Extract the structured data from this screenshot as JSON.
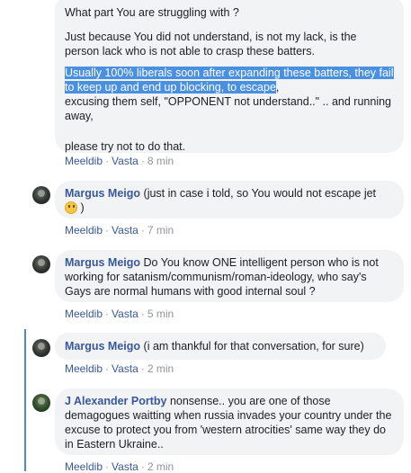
{
  "comments": [
    {
      "paragraphs": [
        "What part You are struggling with ?",
        "Just because You did not understand, is not my lack, is the person lack who is not able to crasp these batters."
      ],
      "selected_text": "Usually 100% liberals soon after expanding these batters, they fail to keep up and end up blocking, to escape",
      "after_selected": ",",
      "line_a": "excusing them self, \"OPPONENT not understand..\" .. and running away,",
      "line_b": "please try not to do that.",
      "actions": {
        "like": "Meeldib",
        "reply": "Vasta",
        "time": "8 min"
      }
    },
    {
      "author": "Margus Meigo",
      "text": "(just in case i told, so You would not escape jet",
      "text_after_emoji": ")",
      "emoji": "grinning-emoji",
      "actions": {
        "like": "Meeldib",
        "reply": "Vasta",
        "time": "7 min"
      }
    },
    {
      "author": "Margus Meigo",
      "text": "Do You know ONE intelligent person who is not working for satanism/communism/roman-ideology, who say's Gays are normal humans with good internal soul ?",
      "actions": {
        "like": "Meeldib",
        "reply": "Vasta",
        "time": "5 min"
      }
    },
    {
      "author": "Margus Meigo",
      "text": "(i am thankful for that conversation, for sure)",
      "actions": {
        "like": "Meeldib",
        "reply": "Vasta",
        "time": "2 min"
      }
    },
    {
      "author": "J Alexander Portby",
      "text": "nonsense.. you are one of those demagogues waitting when russia invades your country under the excuse to protect you from 'western atrocities' same way they do in Eastern Ukraine..",
      "actions": {
        "like": "Meeldib",
        "reply": "Vasta",
        "time": "2 min"
      }
    }
  ],
  "separator": "·",
  "colors": {
    "link": "#385898",
    "bubble": "#f2f3f5",
    "selection": "#4a90e2",
    "thread_line": "#4a8ad4"
  }
}
